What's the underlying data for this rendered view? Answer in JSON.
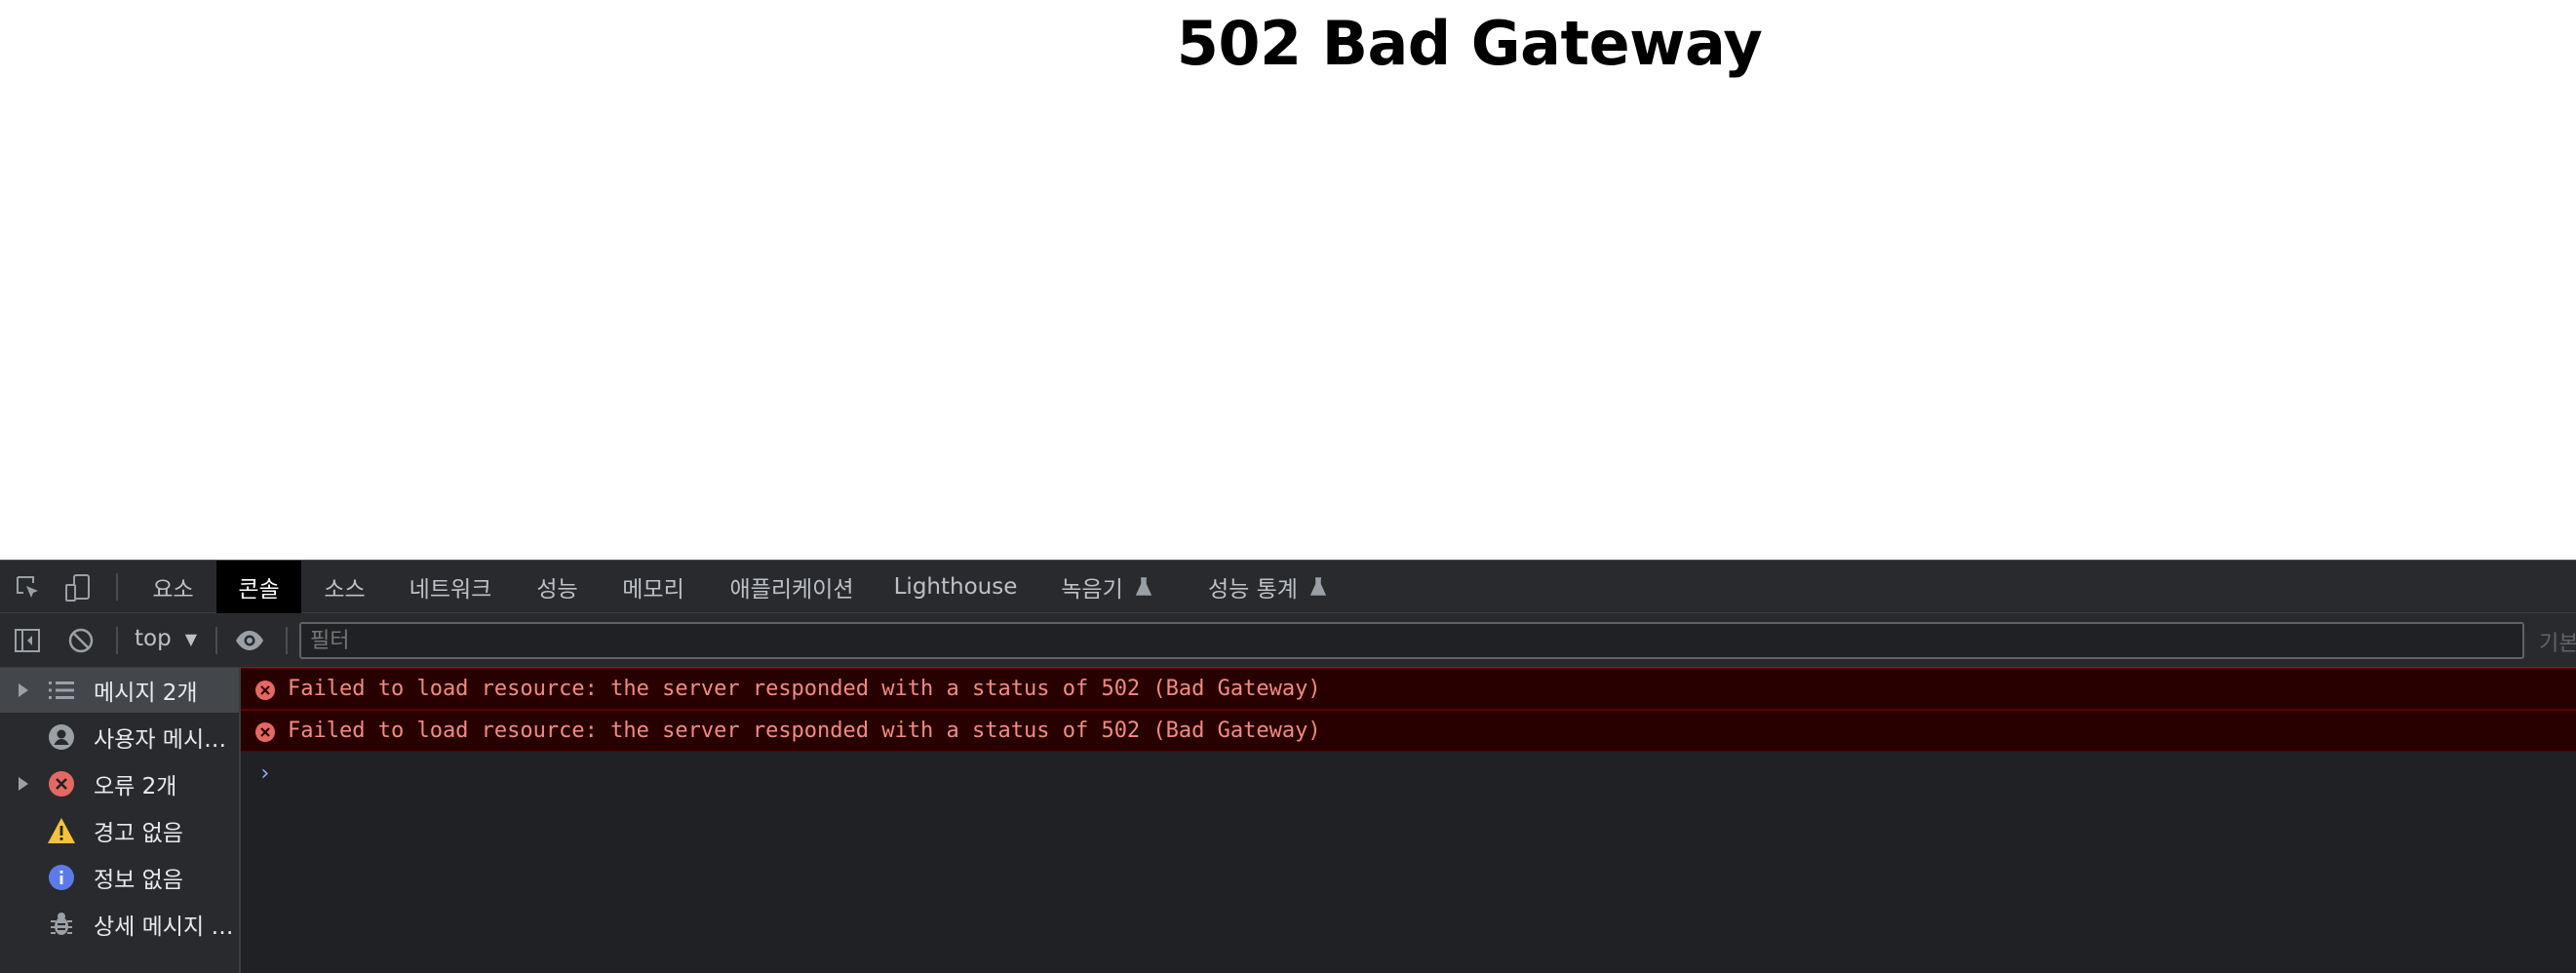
{
  "page": {
    "title": "502 Bad Gateway"
  },
  "devtools": {
    "tabs": [
      {
        "label": "요소"
      },
      {
        "label": "콘솔",
        "active": true
      },
      {
        "label": "소스"
      },
      {
        "label": "네트워크"
      },
      {
        "label": "성능"
      },
      {
        "label": "메모리"
      },
      {
        "label": "애플리케이션"
      },
      {
        "label": "Lighthouse"
      },
      {
        "label": "녹음기",
        "icon": "flask-icon"
      },
      {
        "label": "성능 통계",
        "icon": "flask-icon"
      }
    ],
    "toolbar": {
      "context": "top",
      "filter_placeholder": "필터",
      "levels_label": "기본"
    },
    "sidebar": [
      {
        "label": "메시지 2개",
        "icon": "list-icon",
        "expandable": true,
        "selected": true
      },
      {
        "label": "사용자 메시지 없음",
        "icon": "user-icon"
      },
      {
        "label": "오류 2개",
        "icon": "error-icon",
        "expandable": true
      },
      {
        "label": "경고 없음",
        "icon": "warning-icon"
      },
      {
        "label": "정보 없음",
        "icon": "info-icon"
      },
      {
        "label": "상세 메시지 없음",
        "icon": "bug-icon"
      }
    ],
    "messages": [
      {
        "level": "error",
        "text": "Failed to load resource: the server responded with a status of 502 (Bad Gateway)"
      },
      {
        "level": "error",
        "text": "Failed to load resource: the server responded with a status of 502 (Bad Gateway)"
      }
    ],
    "prompt_symbol": "›",
    "colors": {
      "error_text": "#f28b82",
      "error_bg": "#290000",
      "accent": "#8ab4f8"
    }
  }
}
